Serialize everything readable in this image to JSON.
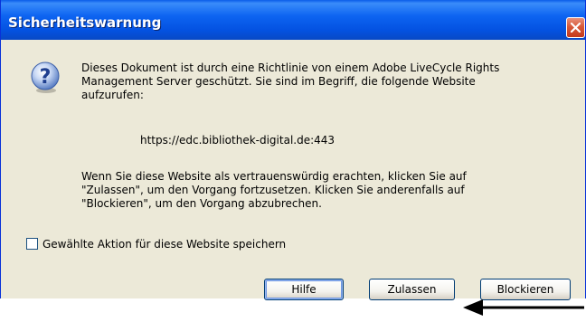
{
  "dialog": {
    "title": "Sicherheitswarnung",
    "close_icon": "close-icon",
    "help_icon": "question-icon"
  },
  "message": {
    "intro_lines": [
      "Dieses Dokument ist durch eine Richtlinie von einem Adobe LiveCycle Rights",
      "Management Server geschützt. Sie sind im Begriff, die folgende Website",
      "aufzurufen:"
    ],
    "url": "https://edc.bibliothek-digital.de:443",
    "body_lines": [
      "Wenn Sie diese Website als vertrauenswürdig erachten, klicken Sie auf",
      "\"Zulassen\", um den Vorgang fortzusetzen. Klicken Sie anderenfalls auf",
      "\"Blockieren\", um den Vorgang abzubrechen."
    ]
  },
  "remember": {
    "label": "Gewählte Aktion für diese Website speichern",
    "checked": false
  },
  "buttons": {
    "help": "Hilfe",
    "allow": "Zulassen",
    "block": "Blockieren"
  },
  "colors": {
    "titlebar": "#0d64f1",
    "dialog_bg": "#ece9d8",
    "close_button": "#d85a3a"
  }
}
